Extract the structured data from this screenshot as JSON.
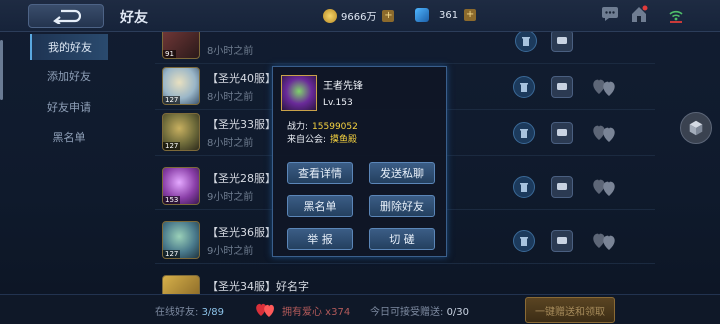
{
  "header": {
    "title": "好友",
    "resources": [
      {
        "icon": "gold-coin-icon",
        "value": "9666万"
      },
      {
        "icon": "blue-gem-icon",
        "value": "361"
      }
    ]
  },
  "sidebar": {
    "items": [
      {
        "label": "我的好友",
        "active": true
      },
      {
        "label": "添加好友",
        "active": false
      },
      {
        "label": "好友申请",
        "active": false
      },
      {
        "label": "黑名单",
        "active": false
      }
    ]
  },
  "friends": [
    {
      "name": "",
      "time": "8小时之前",
      "level": "91"
    },
    {
      "name": "【圣光40服】",
      "time": "8小时之前",
      "level": "127"
    },
    {
      "name": "【圣光33服】",
      "time": "8小时之前",
      "level": "127"
    },
    {
      "name": "【圣光28服】",
      "time": "9小时之前",
      "level": "153"
    },
    {
      "name": "【圣光36服】",
      "time": "9小时之前",
      "level": "127"
    },
    {
      "name": "【圣光34服】好名字",
      "time": "",
      "level": ""
    }
  ],
  "popup": {
    "name": "王者先锋",
    "level": "Lv.153",
    "power_label": "战力:",
    "power_value": "15599052",
    "guild_label": "来自公会:",
    "guild_value": "摸鱼殿",
    "buttons": {
      "details": "查看详情",
      "private_chat": "发送私聊",
      "blacklist": "黑名单",
      "delete_friend": "删除好友",
      "report": "举 报",
      "duel": "切 磋"
    }
  },
  "footer": {
    "online_label": "在线好友:",
    "online_value": "3/89",
    "love_label": "拥有爱心 x374",
    "receive_label": "今日可接受赠送:",
    "receive_value": "0/30",
    "oneclick_label": "一键赠送和领取"
  },
  "colors": {
    "accent": "#5b86b8",
    "highlight": "#f6d340"
  }
}
